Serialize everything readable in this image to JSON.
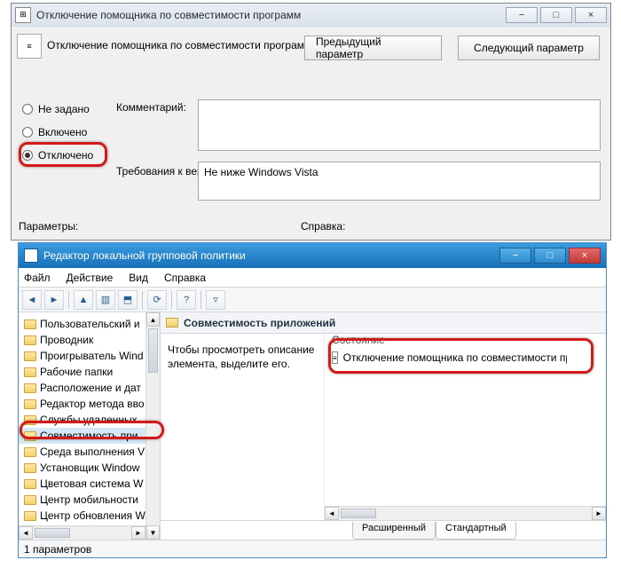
{
  "dialog": {
    "title": "Отключение помощника по совместимости программ",
    "header": "Отключение помощника по совместимости программ",
    "btn_prev": "Предыдущий параметр",
    "btn_next": "Следующий параметр",
    "radio_not_set": "Не задано",
    "radio_enabled": "Включено",
    "radio_disabled": "Отключено",
    "label_comment": "Комментарий:",
    "label_requirements": "Требования к версии:",
    "req_value": "Не ниже Windows Vista",
    "label_params": "Параметры:",
    "label_help": "Справка:"
  },
  "gpedit": {
    "title": "Редактор локальной групповой политики",
    "menu": {
      "file": "Файл",
      "action": "Действие",
      "view": "Вид",
      "help": "Справка"
    },
    "tree": [
      "Пользовательский и",
      "Проводник",
      "Проигрыватель Wind",
      "Рабочие папки",
      "Расположение и дат",
      "Редактор метода вво",
      "Службы удаленных ",
      "Совместимость при",
      "Среда выполнения V",
      "Установщик Window",
      "Цветовая система W",
      "Центр мобильности",
      "Центр обновления W"
    ],
    "content_header": "Совместимость приложений",
    "description": "Чтобы просмотреть описание элемента, выделите его.",
    "col_state": "Состояние",
    "item_text": "Отключение помощника по совместимости прогр",
    "tab_ext": "Расширенный",
    "tab_std": "Стандартный",
    "status": "1 параметров"
  }
}
